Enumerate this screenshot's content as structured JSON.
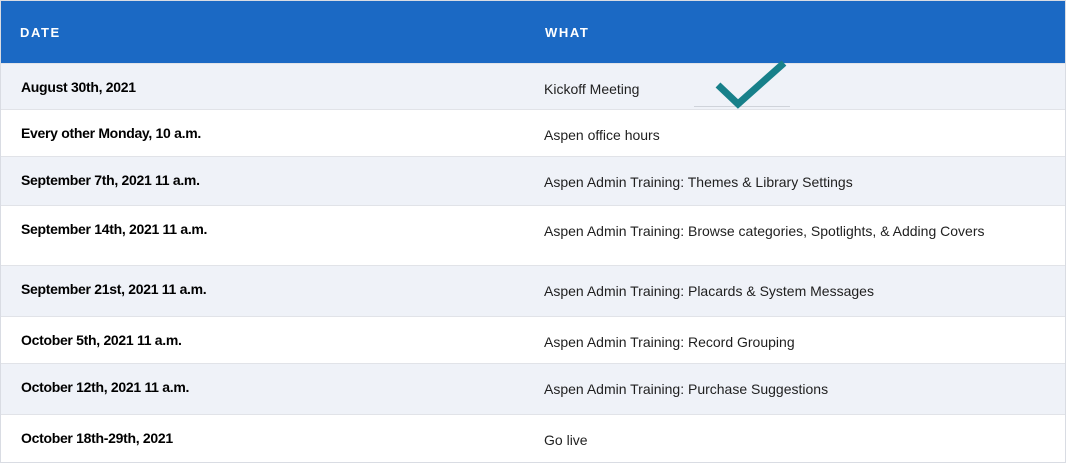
{
  "table": {
    "headers": {
      "date": "DATE",
      "what": "WHAT"
    },
    "rows": [
      {
        "date": "August 30th, 2021",
        "what": "Kickoff Meeting"
      },
      {
        "date": "Every other Monday, 10 a.m.",
        "what": "Aspen office hours"
      },
      {
        "date": "September 7th, 2021 11 a.m.",
        "what": "Aspen Admin Training: Themes & Library Settings"
      },
      {
        "date": "September 14th, 2021 11 a.m.",
        "what": "Aspen Admin Training: Browse categories, Spotlights, & Adding Covers"
      },
      {
        "date": "September 21st, 2021 11 a.m.",
        "what": "Aspen Admin Training: Placards & System Messages"
      },
      {
        "date": "October 5th, 2021 11 a.m.",
        "what": "Aspen Admin Training: Record Grouping"
      },
      {
        "date": "October 12th, 2021 11 a.m.",
        "what": "Aspen Admin Training: Purchase Suggestions"
      },
      {
        "date": "October 18th-29th, 2021",
        "what": "Go live"
      }
    ]
  },
  "colors": {
    "header_bg": "#1b69c4",
    "alt_row_bg": "#eff2f8",
    "checkmark": "#17808a"
  },
  "icons": {
    "completed": "checkmark-icon"
  }
}
